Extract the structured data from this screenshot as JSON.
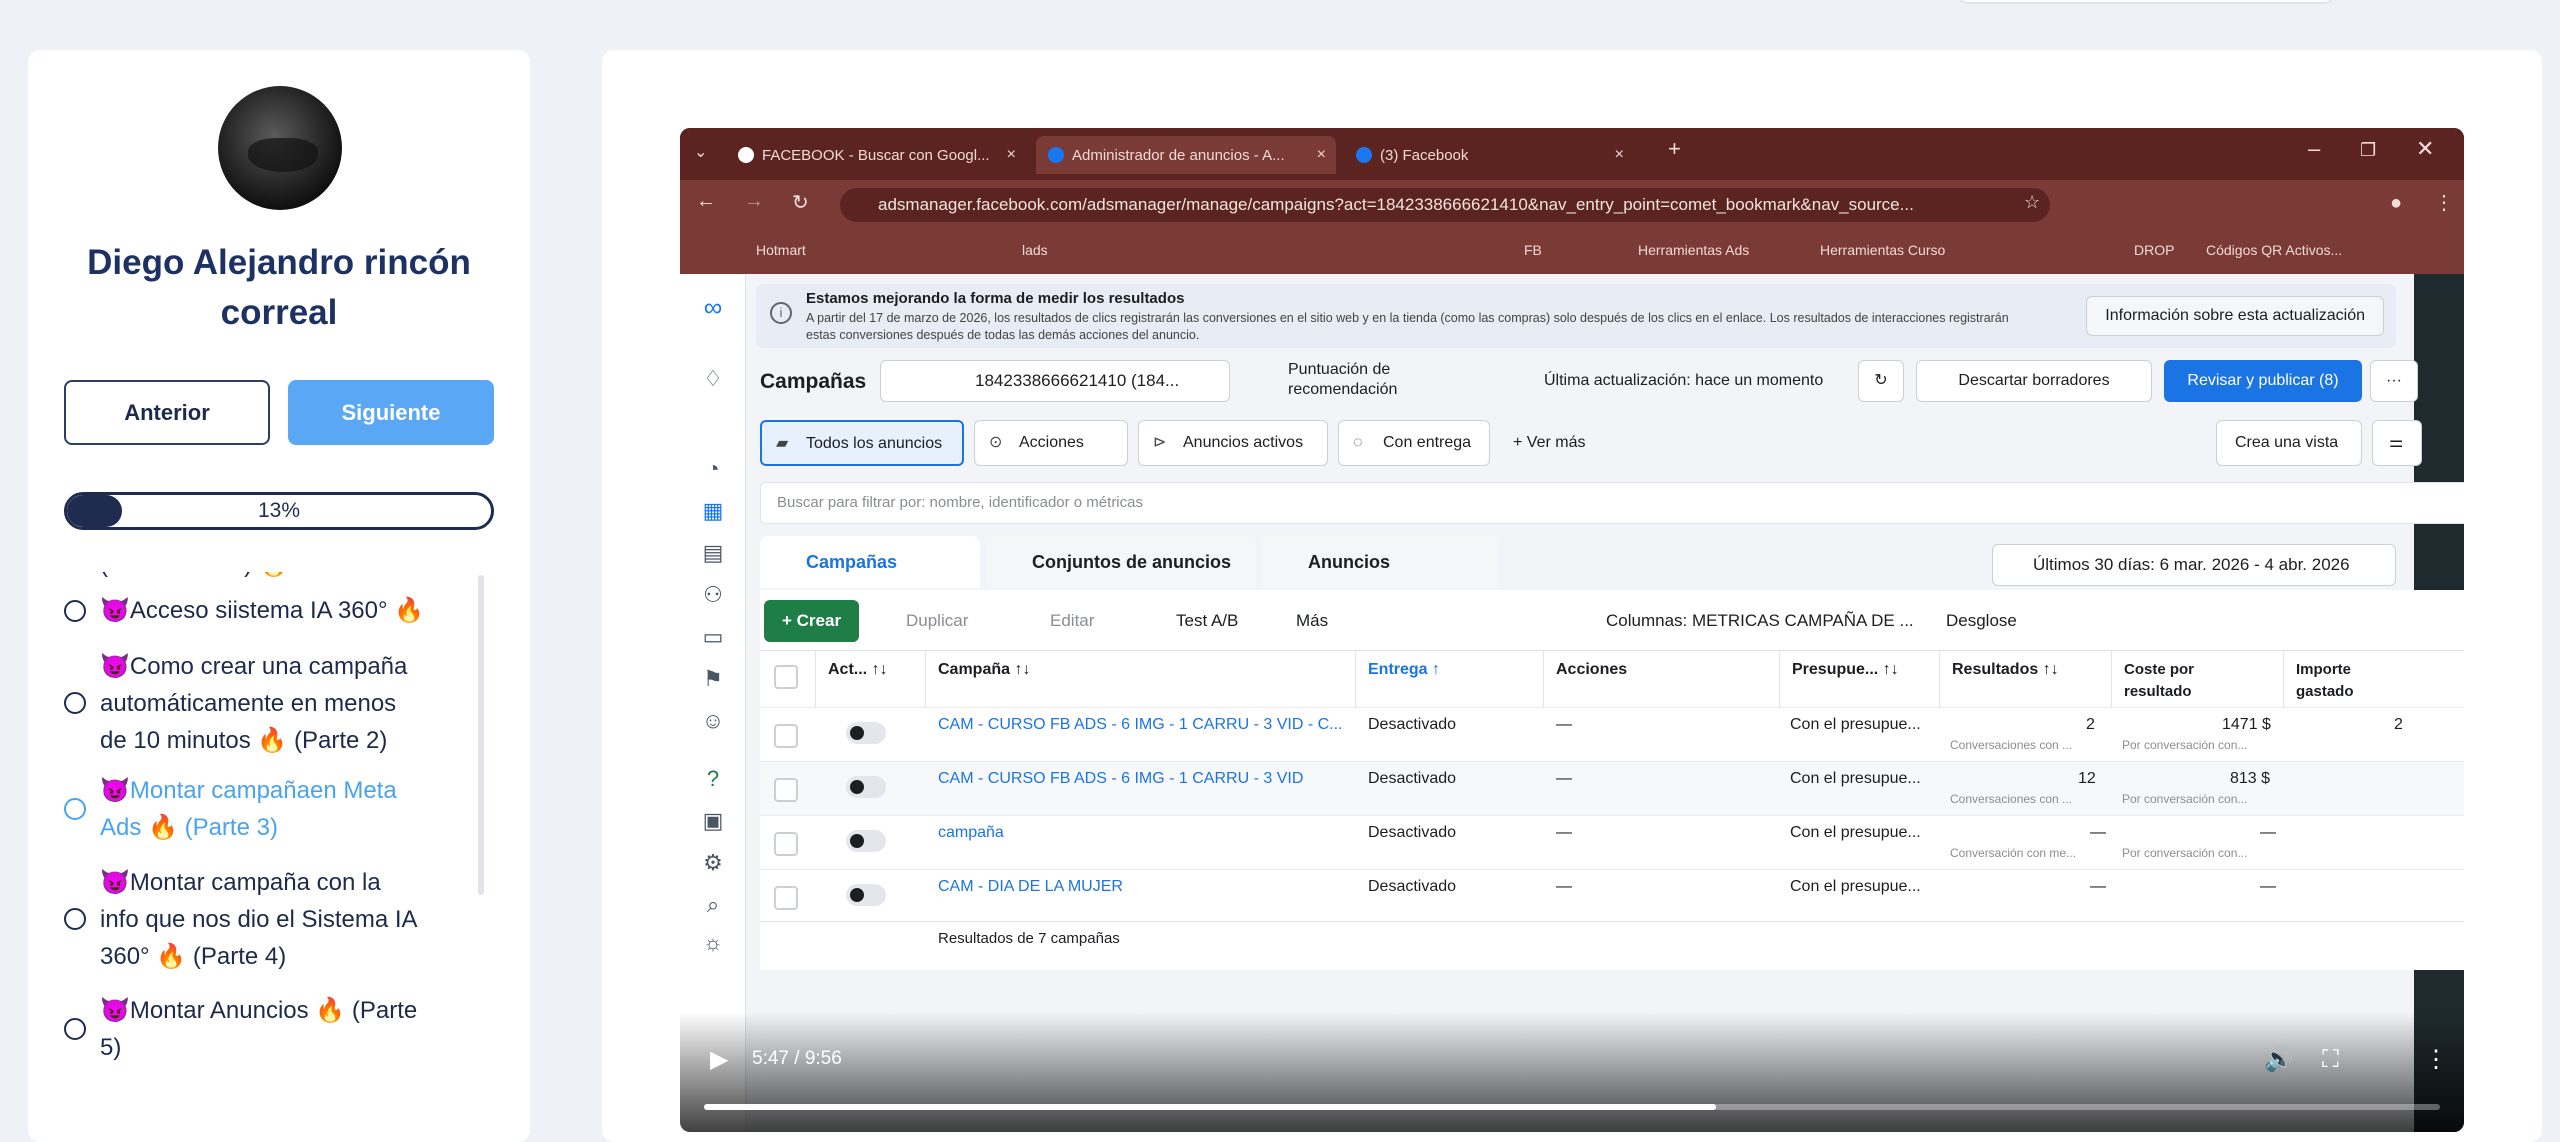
{
  "user": {
    "name": "Diego Alejandro rincón\ncorreal"
  },
  "nav": {
    "prev_label": "Anterior",
    "next_label": "Siguiente"
  },
  "progress": {
    "percent": 13,
    "label": "13%"
  },
  "lessons": [
    {
      "title": "(introducción ) 🔥",
      "status": "partial"
    },
    {
      "title": "😈Acceso siistema IA 360° 🔥",
      "status": "normal"
    },
    {
      "title": "😈Como crear una campaña\nautomáticamente en menos\nde 10 minutos 🔥 (Parte 2)",
      "status": "normal"
    },
    {
      "title": "😈Montar campañaen Meta\nAds 🔥 (Parte 3)",
      "status": "active"
    },
    {
      "title": "😈Montar campaña con la\ninfo que nos dio el Sistema IA\n360° 🔥 (Parte 4)",
      "status": "normal"
    },
    {
      "title": "😈Montar Anuncios 🔥 (Parte\n5)",
      "status": "normal"
    }
  ],
  "browser": {
    "tabs": [
      {
        "title": "FACEBOOK - Buscar con Googl..."
      },
      {
        "title": "Administrador de anuncios - A..."
      },
      {
        "title": "(3) Facebook"
      }
    ],
    "url": "adsmanager.facebook.com/adsmanager/manage/campaigns?act=1842338666621410&nav_entry_point=comet_bookmark&nav_source...",
    "bookmarks": [
      "Hotmart",
      "lads",
      "FB",
      "Herramientas Ads",
      "Herramientas Curso",
      "DROP",
      "Códigos QR Activos..."
    ]
  },
  "ads_manager": {
    "banner_title": "Estamos mejorando la forma de medir los resultados",
    "banner_text": "A partir del 17 de marzo de 2026, los resultados de clics registrarán las conversiones en el sitio web y en la tienda (como las compras) solo después de los clics en el enlace. Los resultados de interacciones registrarán estas conversiones después de todas las demás acciones del anuncio.",
    "banner_button": "Información sobre esta actualización",
    "heading": "Campañas",
    "account": "1842338666621410 (184...",
    "score_label": "Puntuación de\nrecomendación",
    "last_update": "Última actualización: hace un momento",
    "discard_label": "Descartar borradores",
    "publish_label": "Revisar y publicar (8)",
    "views": [
      "Todos los anuncios",
      "Acciones",
      "Anuncios activos",
      "Con entrega",
      "+ Ver más"
    ],
    "create_view": "Crea una vista",
    "search_placeholder": "Buscar para filtrar por: nombre, identificador o métricas",
    "levels": [
      "Campañas",
      "Conjuntos de anuncios",
      "Anuncios"
    ],
    "date_range": "Últimos 30 días: 6 mar. 2026 - 4 abr. 2026",
    "toolbar": {
      "create": "+ Crear",
      "duplicate": "Duplicar",
      "edit": "Editar",
      "ab": "Test A/B",
      "more": "Más",
      "columns": "Columnas: METRICAS CAMPAÑA DE ...",
      "breakdown": "Desglose"
    },
    "columns": [
      "Act... ↑↓",
      "Campaña ↑↓",
      "Entrega ↑",
      "Acciones",
      "Presupue... ↑↓",
      "Resultados ↑↓",
      "Coste por\nresultado",
      "Importe\ngastado"
    ],
    "rows": [
      {
        "name": "CAM - CURSO FB ADS - 6 IMG - 1 CARRU - 3 VID - C...",
        "delivery": "Desactivado",
        "actions": "—",
        "budget": "Con el presupue...",
        "results": "2",
        "results_sub": "Conversaciones con ...",
        "cost": "1471 $",
        "cost_sub": "Por conversación con...",
        "spent": "2"
      },
      {
        "name": "CAM - CURSO FB ADS - 6 IMG - 1 CARRU - 3 VID",
        "delivery": "Desactivado",
        "actions": "—",
        "budget": "Con el presupue...",
        "results": "12",
        "results_sub": "Conversaciones con ...",
        "cost": "813 $",
        "cost_sub": "Por conversación con...",
        "spent": ""
      },
      {
        "name": "campaña",
        "delivery": "Desactivado",
        "actions": "—",
        "budget": "Con el presupue...",
        "results": "—",
        "results_sub": "Conversación con me...",
        "cost": "—",
        "cost_sub": "Por conversación con...",
        "spent": ""
      },
      {
        "name": "CAM - DIA DE LA MUJER",
        "delivery": "Desactivado",
        "actions": "—",
        "budget": "Con el presupue...",
        "results": "—",
        "results_sub": "",
        "cost": "—",
        "cost_sub": "",
        "spent": ""
      }
    ],
    "footer": "Resultados de 7 campañas"
  },
  "video": {
    "time": "5:47 / 9:56",
    "played_fraction": 0.583
  }
}
